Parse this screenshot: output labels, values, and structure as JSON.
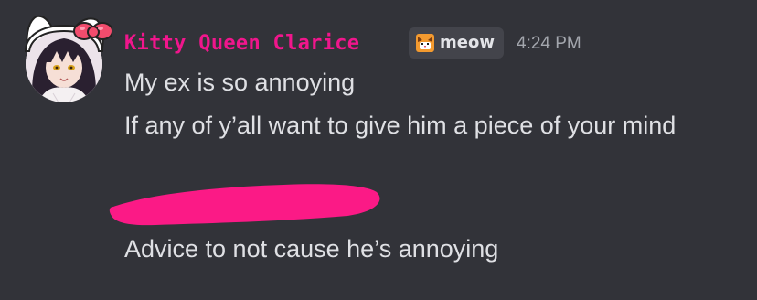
{
  "message": {
    "author": {
      "username": "Kitty Queen Clarice",
      "name_color": "#f0168c",
      "avatar": "anime-girl-avatar",
      "avatar_decoration": "hello-kitty-bow-ears"
    },
    "tag": {
      "icon": "cat-face-icon",
      "label": "meow"
    },
    "timestamp": "4:24 PM",
    "lines": [
      "My ex is so annoying",
      "If any of y’all want to give him a piece of your mind",
      "Advice to not cause he’s annoying"
    ],
    "redaction": {
      "type": "pink-marker-scribble",
      "color": "#fb1a86"
    }
  },
  "theme": {
    "background": "#323339",
    "text": "#dfe0e4",
    "muted": "#a3a6ad"
  }
}
